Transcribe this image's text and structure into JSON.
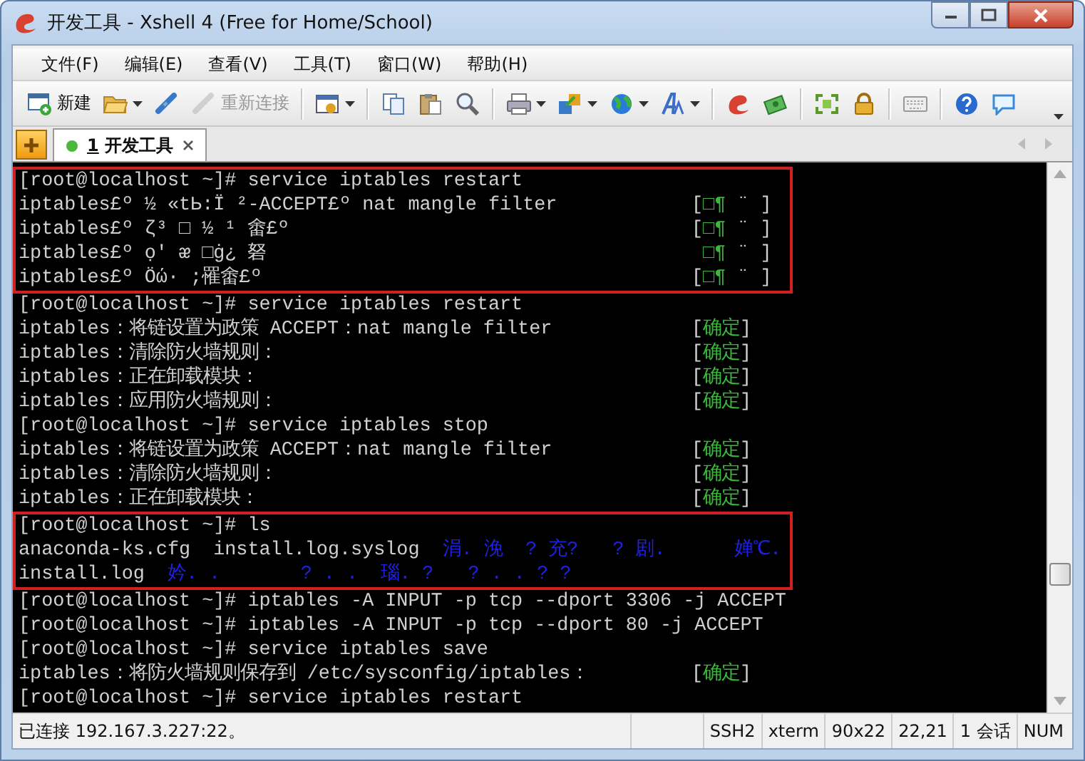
{
  "window": {
    "title": "开发工具 - Xshell 4 (Free for Home/School)"
  },
  "menu": [
    "文件(F)",
    "编辑(E)",
    "查看(V)",
    "工具(T)",
    "窗口(W)",
    "帮助(H)"
  ],
  "toolbar": [
    [
      {
        "kind": "new",
        "label": "新建",
        "dropdown": false,
        "disabled": false
      },
      {
        "kind": "open",
        "dropdown": true,
        "disabled": false
      },
      {
        "kind": "connect",
        "dropdown": false,
        "disabled": false
      },
      {
        "kind": "reconnect",
        "label": "重新连接",
        "dropdown": false,
        "disabled": true
      }
    ],
    [
      {
        "kind": "properties",
        "dropdown": true,
        "disabled": false
      }
    ],
    [
      {
        "kind": "copy",
        "dropdown": false,
        "disabled": false
      },
      {
        "kind": "paste",
        "dropdown": false,
        "disabled": false
      },
      {
        "kind": "find",
        "dropdown": false,
        "disabled": false
      }
    ],
    [
      {
        "kind": "print",
        "dropdown": true,
        "disabled": false
      },
      {
        "kind": "transfer",
        "dropdown": true,
        "disabled": false
      },
      {
        "kind": "globe",
        "dropdown": true,
        "disabled": false
      },
      {
        "kind": "font",
        "dropdown": true,
        "disabled": false
      }
    ],
    [
      {
        "kind": "xshell",
        "dropdown": false,
        "disabled": false
      },
      {
        "kind": "xftp",
        "dropdown": false,
        "disabled": false
      }
    ],
    [
      {
        "kind": "fullscreen",
        "dropdown": false,
        "disabled": false
      },
      {
        "kind": "lock",
        "dropdown": false,
        "disabled": false
      }
    ],
    [
      {
        "kind": "keyboard",
        "dropdown": false,
        "disabled": false
      }
    ],
    [
      {
        "kind": "help",
        "dropdown": false,
        "disabled": false
      },
      {
        "kind": "chat",
        "dropdown": false,
        "disabled": false
      }
    ]
  ],
  "tabs": [
    {
      "number": "1",
      "label": "开发工具",
      "selected": true
    }
  ],
  "terminal": {
    "lines": [
      {
        "text": "[root@localhost ~]# service iptables restart",
        "marked": true
      },
      {
        "text": "iptables£º ½ «tЬ:Ï ²-ACCEPT£º nat mangle filter",
        "status": [
          {
            "kind": "bracket",
            "text": "["
          },
          {
            "kind": "ok",
            "text": "□¶"
          },
          {
            "kind": "bracket",
            "text": " ¨ ]"
          }
        ],
        "marked": true
      },
      {
        "text": "iptables£º ζ³ □ ½ ¹ 畬£º",
        "status": [
          {
            "kind": "bracket",
            "text": "["
          },
          {
            "kind": "ok",
            "text": "□¶"
          },
          {
            "kind": "bracket",
            "text": " ¨ ]"
          }
        ],
        "marked": true
      },
      {
        "text": "iptables£º ọ' ᴂ □ġ¿ 砮",
        "status": [
          {
            "kind": "ok",
            "text": " □¶"
          },
          {
            "kind": "bracket",
            "text": " ¨ ]"
          }
        ],
        "marked": true
      },
      {
        "text": "iptables£º Öώ· ;罹畬£º",
        "status": [
          {
            "kind": "bracket",
            "text": "["
          },
          {
            "kind": "ok",
            "text": "□¶"
          },
          {
            "kind": "bracket",
            "text": " ¨ ]"
          }
        ],
        "marked": true
      },
      {
        "text": "[root@localhost ~]# service iptables restart",
        "marked": false
      },
      {
        "text": "iptables：将链设置为政策 ACCEPT：nat mangle filter",
        "status": [
          {
            "kind": "bracket",
            "text": "["
          },
          {
            "kind": "ok",
            "text": "确定"
          },
          {
            "kind": "bracket",
            "text": "]"
          }
        ],
        "marked": false
      },
      {
        "text": "iptables：清除防火墙规则：",
        "status": [
          {
            "kind": "bracket",
            "text": "["
          },
          {
            "kind": "ok",
            "text": "确定"
          },
          {
            "kind": "bracket",
            "text": "]"
          }
        ],
        "marked": false
      },
      {
        "text": "iptables：正在卸载模块：",
        "status": [
          {
            "kind": "bracket",
            "text": "["
          },
          {
            "kind": "ok",
            "text": "确定"
          },
          {
            "kind": "bracket",
            "text": "]"
          }
        ],
        "marked": false
      },
      {
        "text": "iptables：应用防火墙规则：",
        "status": [
          {
            "kind": "bracket",
            "text": "["
          },
          {
            "kind": "ok",
            "text": "确定"
          },
          {
            "kind": "bracket",
            "text": "]"
          }
        ],
        "marked": false
      },
      {
        "text": "[root@localhost ~]# service iptables stop",
        "marked": false
      },
      {
        "text": "iptables：将链设置为政策 ACCEPT：nat mangle filter",
        "status": [
          {
            "kind": "bracket",
            "text": "["
          },
          {
            "kind": "ok",
            "text": "确定"
          },
          {
            "kind": "bracket",
            "text": "]"
          }
        ],
        "marked": false
      },
      {
        "text": "iptables：清除防火墙规则：",
        "status": [
          {
            "kind": "bracket",
            "text": "["
          },
          {
            "kind": "ok",
            "text": "确定"
          },
          {
            "kind": "bracket",
            "text": "]"
          }
        ],
        "marked": false
      },
      {
        "text": "iptables：正在卸载模块：",
        "status": [
          {
            "kind": "bracket",
            "text": "["
          },
          {
            "kind": "ok",
            "text": "确定"
          },
          {
            "kind": "bracket",
            "text": "]"
          }
        ],
        "marked": false
      },
      {
        "text": "[root@localhost ~]# ls",
        "marked": true
      },
      {
        "text": "anaconda-ks.cfg  install.log.syslog",
        "extra": "涓. 浼  ? 充?   ? 剧.      婵℃.",
        "marked": true
      },
      {
        "text": "install.log",
        "extra": "妗. .       ? . .  瑙. ?   ? . . ? ?",
        "marked": true
      },
      {
        "text": "[root@localhost ~]# iptables -A INPUT -p tcp --dport 3306 -j ACCEPT",
        "marked": false
      },
      {
        "text": "[root@localhost ~]# iptables -A INPUT -p tcp --dport 80 -j ACCEPT",
        "marked": false
      },
      {
        "text": "[root@localhost ~]# service iptables save",
        "marked": false
      },
      {
        "text": "iptables：将防火墙规则保存到 /etc/sysconfig/iptables：",
        "status": [
          {
            "kind": "bracket",
            "text": "["
          },
          {
            "kind": "ok",
            "text": "确定"
          },
          {
            "kind": "bracket",
            "text": "]"
          }
        ],
        "marked": false
      },
      {
        "text": "[root@localhost ~]# service iptables restart",
        "marked": false
      }
    ]
  },
  "status_bar": {
    "message": "已连接 192.167.3.227:22。",
    "cells": [
      "SSH2",
      "xterm",
      "90x22",
      "22,21",
      "1 会话",
      "NUM"
    ]
  }
}
